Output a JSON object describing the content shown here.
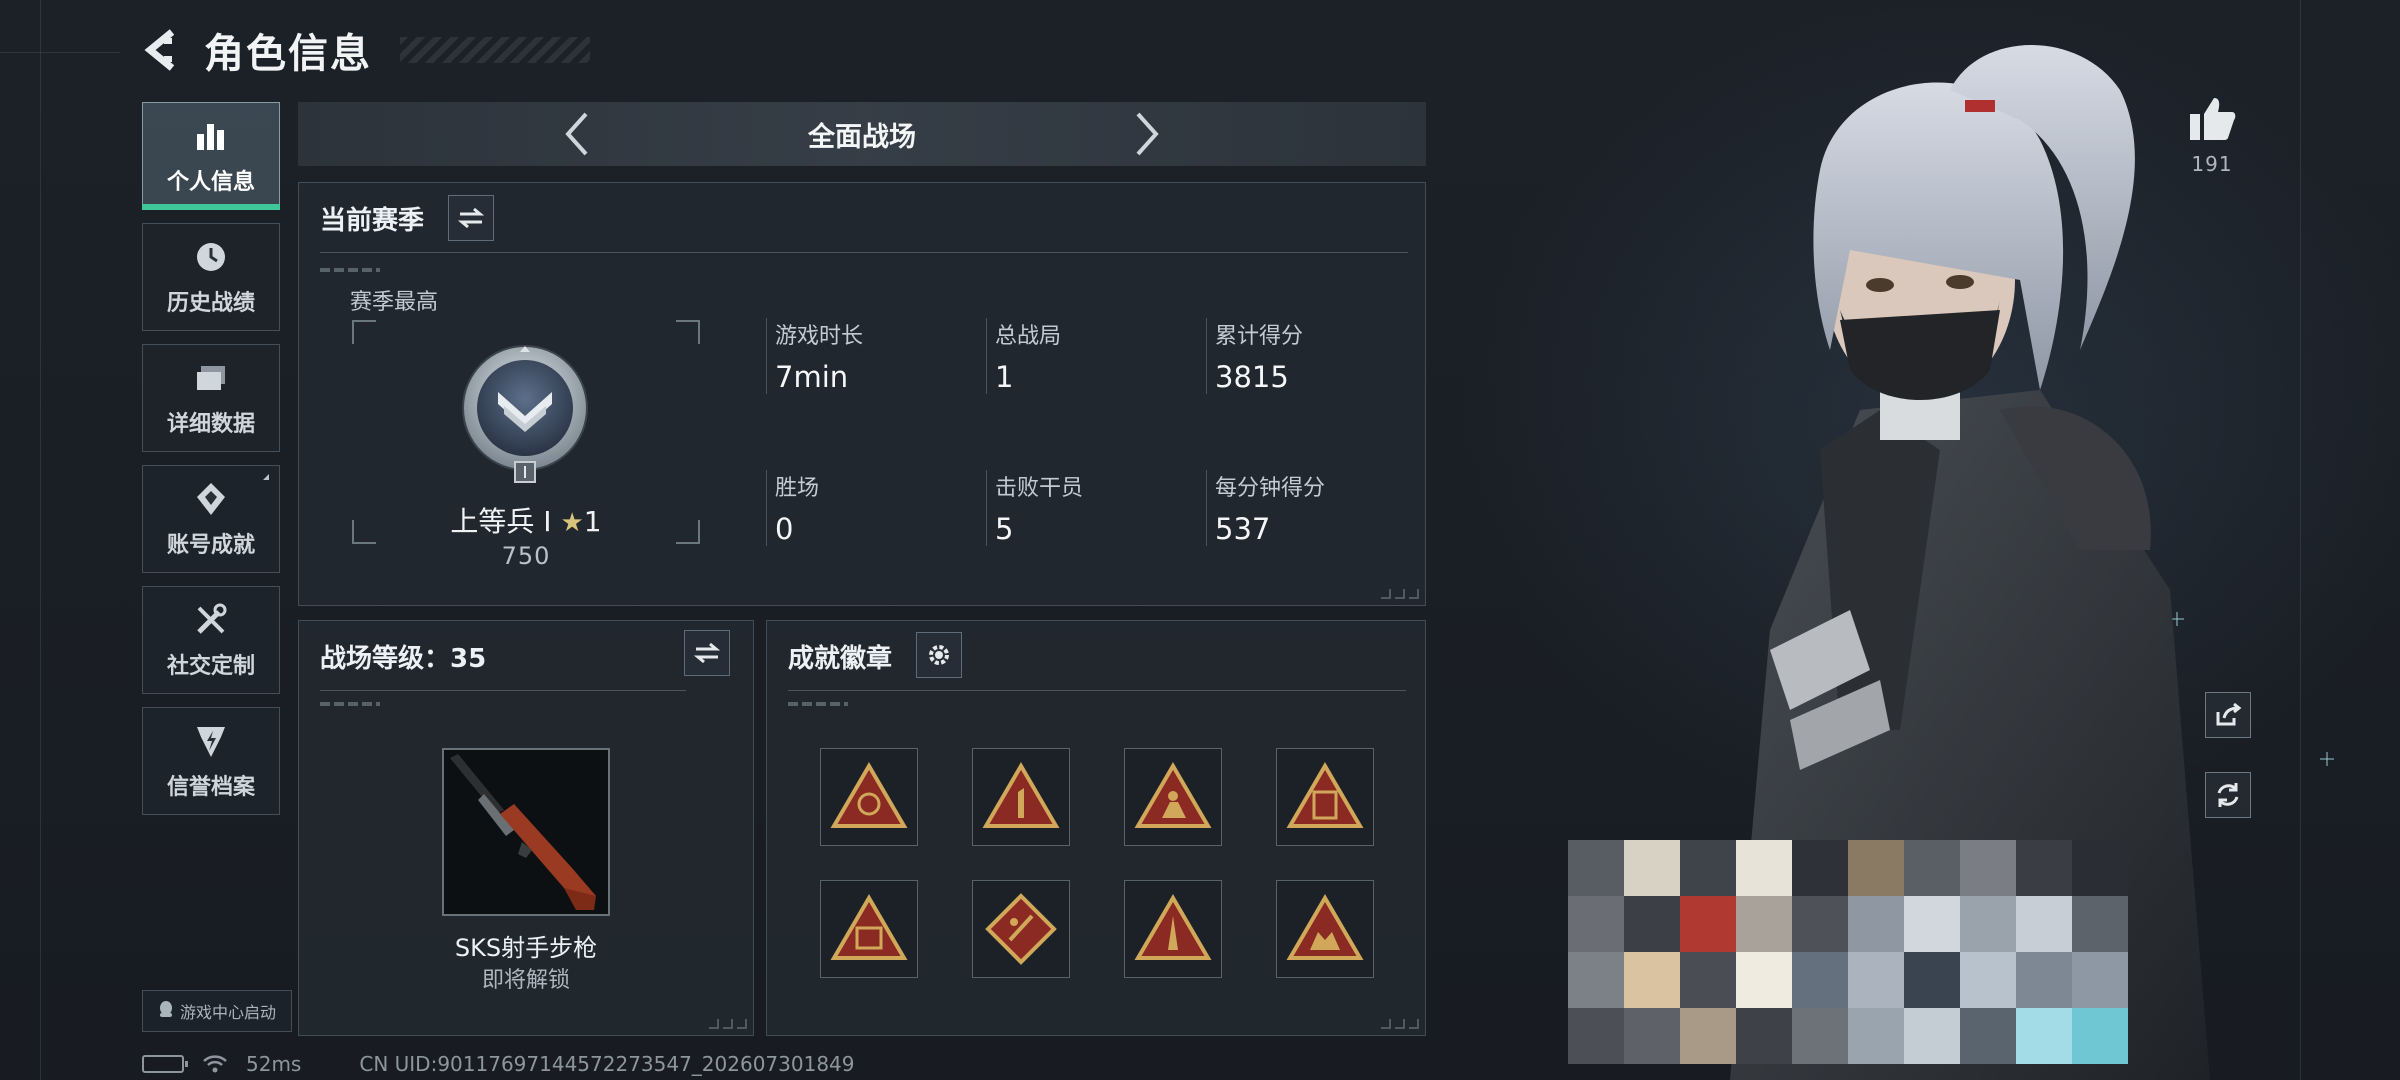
{
  "header": {
    "title": "角色信息"
  },
  "nav": {
    "items": [
      {
        "label": "个人信息",
        "icon": "bar-chart-icon",
        "active": true
      },
      {
        "label": "历史战绩",
        "icon": "clock-icon"
      },
      {
        "label": "详细数据",
        "icon": "folder-icon"
      },
      {
        "label": "账号成就",
        "icon": "achievement-icon"
      },
      {
        "label": "社交定制",
        "icon": "tools-icon"
      },
      {
        "label": "信誉档案",
        "icon": "reputation-icon"
      }
    ]
  },
  "launch": {
    "label": "游戏中心启动"
  },
  "mode": {
    "title": "全面战场"
  },
  "season": {
    "title": "当前赛季",
    "subtitle": "赛季最高",
    "rank_name": "上等兵",
    "rank_tier": "I",
    "rank_stars": "1",
    "rank_points": "750",
    "stats": [
      {
        "label": "游戏时长",
        "value": "7min"
      },
      {
        "label": "总战局",
        "value": "1"
      },
      {
        "label": "累计得分",
        "value": "3815"
      },
      {
        "label": "胜场",
        "value": "0"
      },
      {
        "label": "击败干员",
        "value": "5"
      },
      {
        "label": "每分钟得分",
        "value": "537"
      }
    ]
  },
  "battle_level": {
    "title": "战场等级：35",
    "weapon_name": "SKS射手步枪",
    "weapon_status": "即将解锁"
  },
  "achievements": {
    "title": "成就徽章"
  },
  "social": {
    "likes": "191"
  },
  "status": {
    "ping": "52ms",
    "uid": "CN UID:90117697144572273547_202607301849"
  },
  "colors": {
    "accent": "#3ec89a",
    "badge_gold": "#d1a85a",
    "badge_red": "#8a2a22",
    "panel": "#22282f"
  }
}
